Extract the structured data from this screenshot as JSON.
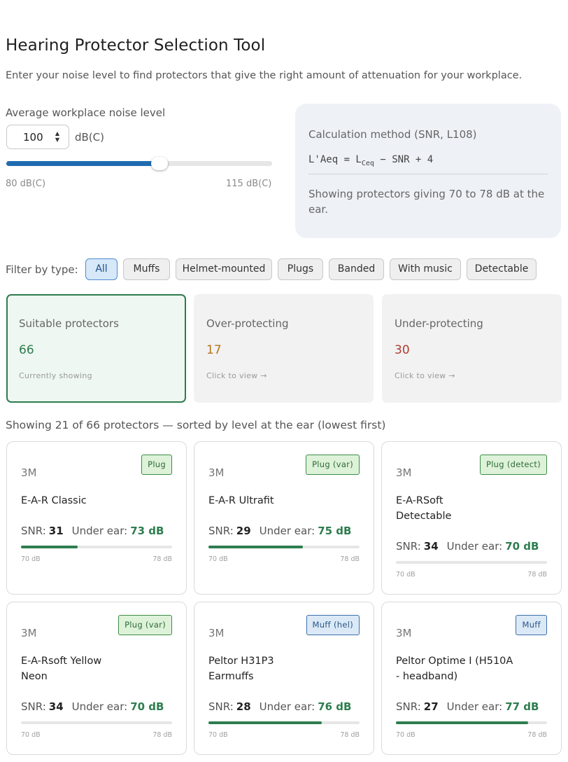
{
  "header": {
    "title": "Hearing Protector Selection Tool",
    "subtitle": "Enter your noise level to find protectors that give the right amount of attenuation for your workplace."
  },
  "noise": {
    "label": "Average workplace noise level",
    "value": "100",
    "unit": "dB(C)",
    "min_label": "80 dB(C)",
    "max_label": "115 dB(C)",
    "min": 80,
    "max": 115,
    "current": 100
  },
  "calc": {
    "title": "Calculation method (SNR, L108)",
    "formula_prefix": "L'Aeq = L",
    "formula_sub": "Ceq",
    "formula_suffix": " − SNR + 4",
    "note": "Showing protectors giving 70 to 78 dB at the ear."
  },
  "filter": {
    "label": "Filter by type:",
    "chips": [
      "All",
      "Muffs",
      "Helmet-mounted",
      "Plugs",
      "Banded",
      "With music",
      "Detectable"
    ],
    "active": "All"
  },
  "stats": [
    {
      "title": "Suitable protectors",
      "count": "66",
      "hint": "Currently showing",
      "color": "#2e7d4f"
    },
    {
      "title": "Over-protecting",
      "count": "17",
      "hint": "Click to view →",
      "color": "#b8741a"
    },
    {
      "title": "Under-protecting",
      "count": "30",
      "hint": "Click to view →",
      "color": "#b23a2e"
    }
  ],
  "results": {
    "showing_text": "Showing 21 of 66 protectors — sorted by level at the ear (lowest first)"
  },
  "card_labels": {
    "snr": "SNR:",
    "under_ear": "Under ear:",
    "range_low": "70 dB",
    "range_high": "78 dB"
  },
  "cards": [
    {
      "brand": "3M",
      "name": "E-A-R Classic",
      "badge": "Plug",
      "badge_kind": "plug",
      "snr": "31",
      "under_ear": "73 dB",
      "level": 73
    },
    {
      "brand": "3M",
      "name": "E-A-R Ultrafit",
      "badge": "Plug (var)",
      "badge_kind": "plug",
      "snr": "29",
      "under_ear": "75 dB",
      "level": 75
    },
    {
      "brand": "3M",
      "name": "E-A-RSoft Detectable",
      "badge": "Plug (detect)",
      "badge_kind": "plug",
      "snr": "34",
      "under_ear": "70 dB",
      "level": 70
    },
    {
      "brand": "3M",
      "name": "E-A-Rsoft Yellow Neon",
      "badge": "Plug (var)",
      "badge_kind": "plug",
      "snr": "34",
      "under_ear": "70 dB",
      "level": 70
    },
    {
      "brand": "3M",
      "name": "Peltor H31P3 Earmuffs",
      "badge": "Muff (hel)",
      "badge_kind": "muff",
      "snr": "28",
      "under_ear": "76 dB",
      "level": 76
    },
    {
      "brand": "3M",
      "name": "Peltor Optime I (H510A - headband)",
      "badge": "Muff",
      "badge_kind": "muff",
      "snr": "27",
      "under_ear": "77 dB",
      "level": 77
    }
  ]
}
